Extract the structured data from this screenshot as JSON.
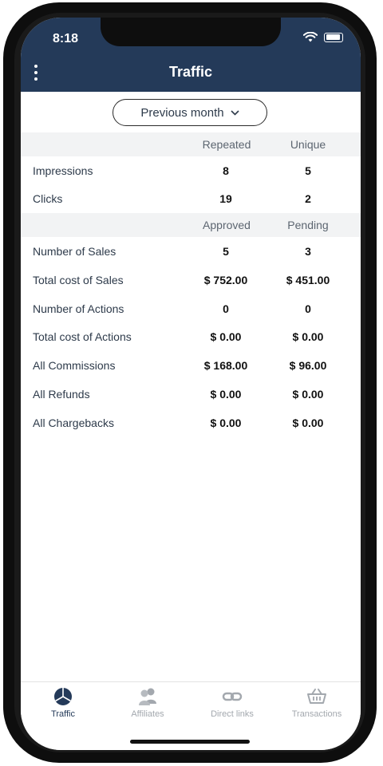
{
  "status_bar": {
    "time": "8:18"
  },
  "header": {
    "title": "Traffic"
  },
  "filter": {
    "label": "Previous month"
  },
  "traffic_section": {
    "columns": [
      "Repeated",
      "Unique"
    ],
    "rows": [
      {
        "label": "Impressions",
        "values": [
          "8",
          "5"
        ]
      },
      {
        "label": "Clicks",
        "values": [
          "19",
          "2"
        ]
      }
    ]
  },
  "sales_section": {
    "columns": [
      "Approved",
      "Pending"
    ],
    "rows": [
      {
        "label": "Number of Sales",
        "values": [
          "5",
          "3"
        ]
      },
      {
        "label": "Total cost of Sales",
        "values": [
          "$ 752.00",
          "$ 451.00"
        ]
      },
      {
        "label": "Number of Actions",
        "values": [
          "0",
          "0"
        ]
      },
      {
        "label": "Total cost of Actions",
        "values": [
          "$ 0.00",
          "$ 0.00"
        ]
      },
      {
        "label": "All Commissions",
        "values": [
          "$ 168.00",
          "$ 96.00"
        ]
      },
      {
        "label": "All Refunds",
        "values": [
          "$ 0.00",
          "$ 0.00"
        ]
      },
      {
        "label": "All Chargebacks",
        "values": [
          "$ 0.00",
          "$ 0.00"
        ]
      }
    ]
  },
  "tabbar": {
    "tabs": [
      {
        "label": "Traffic",
        "icon": "pie-chart-icon",
        "active": true
      },
      {
        "label": "Affiliates",
        "icon": "users-icon",
        "active": false
      },
      {
        "label": "Direct links",
        "icon": "link-icon",
        "active": false
      },
      {
        "label": "Transactions",
        "icon": "basket-icon",
        "active": false
      }
    ]
  },
  "colors": {
    "header_bg": "#243a59",
    "active_tab": "#243a59",
    "inactive_tab": "#a3a8ae",
    "band_bg": "#f2f3f4"
  }
}
